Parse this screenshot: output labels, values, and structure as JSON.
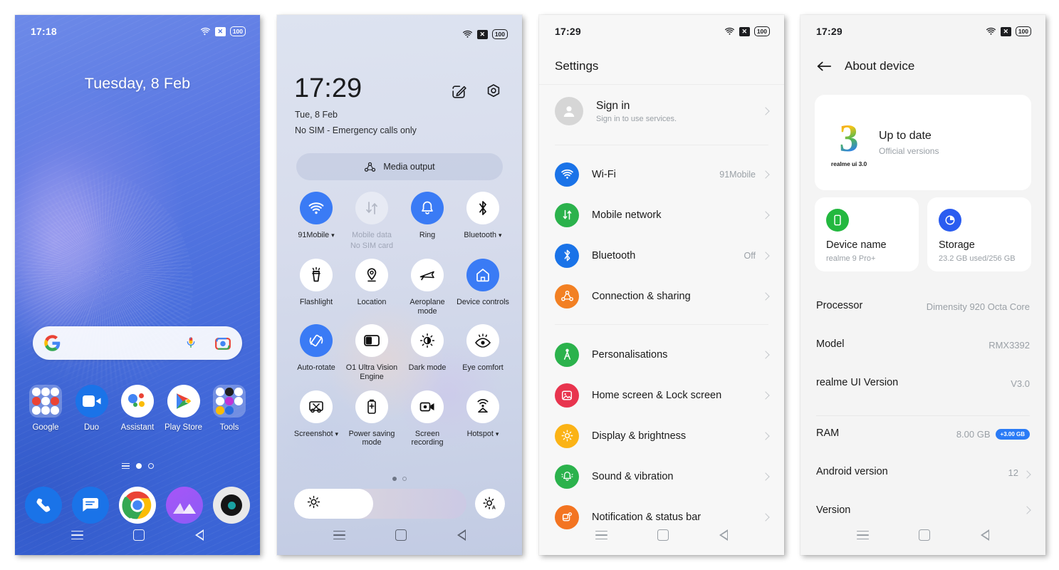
{
  "phone1": {
    "status": {
      "clock": "17:18",
      "wifi": "wifi-icon",
      "signal": "no-signal-icon",
      "battery": "100"
    },
    "lock_date": "Tuesday, 8 Feb",
    "search": {
      "g_logo": "google-g-icon",
      "mic": "microphone-icon",
      "lens": "google-lens-icon",
      "placeholder": ""
    },
    "apps": [
      {
        "label": "Google",
        "icon": "google-folder-icon"
      },
      {
        "label": "Duo",
        "icon": "duo-icon"
      },
      {
        "label": "Assistant",
        "icon": "assistant-icon"
      },
      {
        "label": "Play Store",
        "icon": "play-store-icon"
      },
      {
        "label": "Tools",
        "icon": "tools-folder-icon"
      }
    ],
    "page_indicator": {
      "pages": 2,
      "active": 0
    },
    "dock": [
      {
        "name": "phone-app-icon"
      },
      {
        "name": "messages-app-icon"
      },
      {
        "name": "chrome-app-icon"
      },
      {
        "name": "gallery-app-icon"
      },
      {
        "name": "camera-app-icon"
      }
    ]
  },
  "phone2": {
    "status": {
      "clock": "",
      "wifi": "wifi-icon",
      "signal": "no-signal-icon",
      "battery": "100"
    },
    "time": "17:29",
    "date": "Tue, 8 Feb",
    "sim": "No SIM - Emergency calls only",
    "edit_icon": "edit-icon",
    "settings_icon": "gear-icon",
    "media_output": {
      "label": "Media output",
      "icon": "cast-icon"
    },
    "tiles": [
      {
        "label": "91Mobile",
        "icon": "wifi-icon",
        "state": "on",
        "caret": true
      },
      {
        "label": "Mobile data",
        "sublabel": "No SIM card",
        "icon": "mobile-data-icon",
        "state": "disabled",
        "caret": false
      },
      {
        "label": "Ring",
        "icon": "bell-icon",
        "state": "on",
        "caret": false
      },
      {
        "label": "Bluetooth",
        "icon": "bluetooth-icon",
        "state": "off",
        "caret": true
      },
      {
        "label": "Flashlight",
        "icon": "flashlight-icon",
        "state": "off",
        "caret": false
      },
      {
        "label": "Location",
        "icon": "location-pin-icon",
        "state": "off",
        "caret": false
      },
      {
        "label": "Aeroplane mode",
        "icon": "airplane-icon",
        "state": "off",
        "caret": false
      },
      {
        "label": "Device controls",
        "icon": "home-icon",
        "state": "on",
        "caret": false
      },
      {
        "label": "Auto-rotate",
        "icon": "auto-rotate-icon",
        "state": "on",
        "caret": false
      },
      {
        "label": "O1 Ultra Vision Engine",
        "icon": "vision-engine-icon",
        "state": "off",
        "caret": false
      },
      {
        "label": "Dark mode",
        "icon": "dark-mode-icon",
        "state": "off",
        "caret": false
      },
      {
        "label": "Eye comfort",
        "icon": "eye-comfort-icon",
        "state": "off",
        "caret": false
      },
      {
        "label": "Screenshot",
        "icon": "screenshot-icon",
        "state": "off",
        "caret": true
      },
      {
        "label": "Power saving mode",
        "icon": "battery-saver-icon",
        "state": "off",
        "caret": false
      },
      {
        "label": "Screen recording",
        "icon": "screen-record-icon",
        "state": "off",
        "caret": false
      },
      {
        "label": "Hotspot",
        "icon": "hotspot-icon",
        "state": "off",
        "caret": true
      }
    ],
    "panel_dots": {
      "pages": 2,
      "active": 0
    },
    "brightness": {
      "value_percent": 46,
      "icon": "brightness-icon",
      "auto_icon": "brightness-auto-icon"
    }
  },
  "phone3": {
    "status": {
      "clock": "17:29",
      "wifi": "wifi-icon",
      "signal": "no-signal-icon",
      "battery": "100"
    },
    "header": "Settings",
    "account": {
      "title": "Sign in",
      "subtitle": "Sign in to use services.",
      "icon": "avatar-icon"
    },
    "groups": [
      [
        {
          "title": "Wi-Fi",
          "value": "91Mobile",
          "icon": "wifi-icon",
          "color": "#1a73e8"
        },
        {
          "title": "Mobile network",
          "value": "",
          "icon": "mobile-data-icon",
          "color": "#2bb24c"
        },
        {
          "title": "Bluetooth",
          "value": "Off",
          "icon": "bluetooth-icon",
          "color": "#1a73e8"
        },
        {
          "title": "Connection & sharing",
          "value": "",
          "icon": "connection-sharing-icon",
          "color": "#f28023"
        }
      ],
      [
        {
          "title": "Personalisations",
          "value": "",
          "icon": "personalisation-icon",
          "color": "#2bb24c"
        },
        {
          "title": "Home screen & Lock screen",
          "value": "",
          "icon": "wallpaper-icon",
          "color": "#e8344e"
        },
        {
          "title": "Display & brightness",
          "value": "",
          "icon": "brightness-icon",
          "color": "#fbb316"
        },
        {
          "title": "Sound & vibration",
          "value": "",
          "icon": "bell-icon",
          "color": "#2bb24c"
        },
        {
          "title": "Notification & status bar",
          "value": "",
          "icon": "notification-icon",
          "color": "#f37421"
        }
      ]
    ]
  },
  "phone4": {
    "status": {
      "clock": "17:29",
      "wifi": "wifi-icon",
      "signal": "no-signal-icon",
      "battery": "100"
    },
    "back_icon": "back-arrow-icon",
    "header": "About device",
    "update_card": {
      "logo_number": "3",
      "logo_caption": "realme ui 3.0",
      "title": "Up to date",
      "subtitle": "Official versions"
    },
    "mini_cards": [
      {
        "title": "Device name",
        "subtitle": "realme 9 Pro+",
        "icon": "phone-icon",
        "color": "#23b83f"
      },
      {
        "title": "Storage",
        "subtitle": "23.2 GB used/256 GB",
        "icon": "storage-pie-icon",
        "color": "#2a5cf0"
      }
    ],
    "info_rows": [
      {
        "key": "Processor",
        "value": "Dimensity 920 Octa Core",
        "chevron": false,
        "badge": ""
      },
      {
        "key": "Model",
        "value": "RMX3392",
        "chevron": false,
        "badge": ""
      },
      {
        "key": "realme UI Version",
        "value": "V3.0",
        "chevron": false,
        "badge": "",
        "divider_after": true
      },
      {
        "key": "RAM",
        "value": "8.00 GB",
        "chevron": false,
        "badge": "+3.00 GB"
      },
      {
        "key": "Android version",
        "value": "12",
        "chevron": true,
        "badge": ""
      },
      {
        "key": "Version",
        "value": "",
        "chevron": true,
        "badge": ""
      }
    ]
  },
  "colors": {
    "accent_blue": "#3a7bf5",
    "settings_bg": "#f7f7f7",
    "about_bg": "#f4f4f4",
    "muted_text": "#9aa0a6"
  }
}
